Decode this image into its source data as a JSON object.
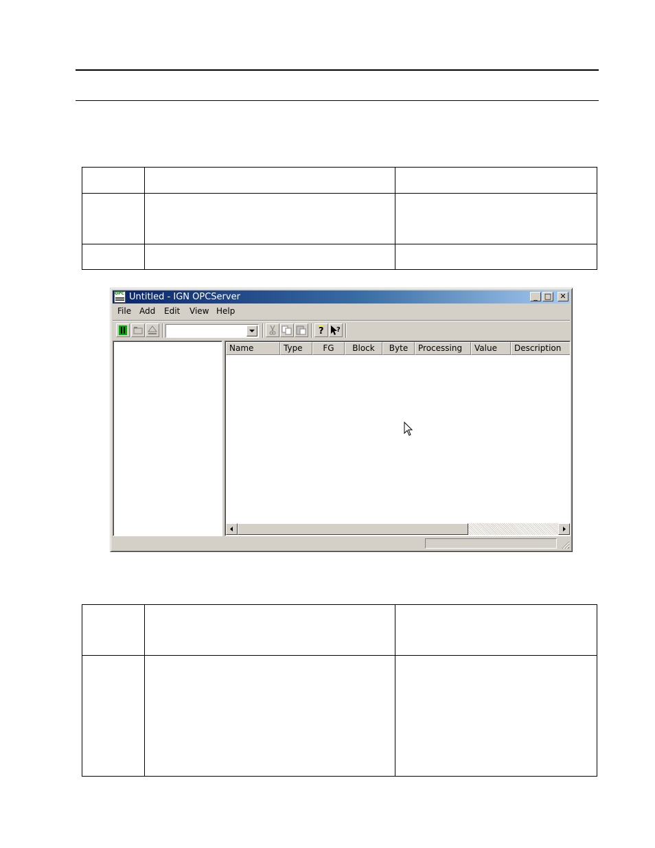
{
  "window": {
    "title": "Untitled - IGN OPCServer",
    "app_icon_text": "OPC",
    "controls": {
      "minimize": "_",
      "maximize": "□",
      "close": "✕"
    }
  },
  "menubar": {
    "items": [
      "File",
      "Add",
      "Edit",
      "View",
      "Help"
    ]
  },
  "toolbar": {
    "buttons": [
      "run-icon",
      "open-folder-icon",
      "eject-icon",
      "cut-icon",
      "copy-icon",
      "paste-icon",
      "about-icon",
      "context-help-icon"
    ],
    "combo_value": ""
  },
  "list": {
    "columns": [
      "Name",
      "Type",
      "FG",
      "Block",
      "Byte",
      "Processing",
      "Value",
      "Description"
    ],
    "rows": []
  },
  "status": {
    "text": ""
  },
  "colors": {
    "title_start": "#0a246a",
    "title_end": "#a6caf0",
    "face": "#d4d0c8"
  }
}
